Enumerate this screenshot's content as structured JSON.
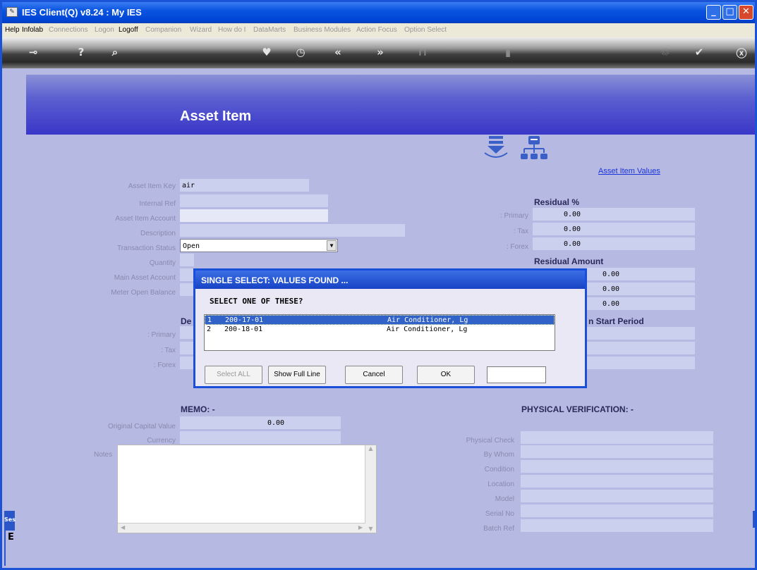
{
  "window": {
    "title": "IES Client(Q) v8.24 : My IES"
  },
  "menu": [
    {
      "label": "Help",
      "on": true
    },
    {
      "label": "Infolab",
      "on": true
    },
    {
      "label": "Connections",
      "on": false
    },
    {
      "label": "Logon",
      "on": false
    },
    {
      "label": "Logoff",
      "on": true
    },
    {
      "label": "Companion",
      "on": false
    },
    {
      "label": "Wizard",
      "on": false
    },
    {
      "label": "How do I",
      "on": false
    },
    {
      "label": "DataMarts",
      "on": false
    },
    {
      "label": "Business Modules",
      "on": false
    },
    {
      "label": "Action Focus",
      "on": false
    },
    {
      "label": "Option Select",
      "on": false
    }
  ],
  "toolbar": {
    "icons": [
      "key-icon",
      "help-icon",
      "search-icon",
      "heart-icon",
      "clock-icon",
      "back-icon",
      "forward-icon",
      "tree-icon",
      "page-icon",
      "recycle-icon",
      "check-icon",
      "close-icon"
    ]
  },
  "page": {
    "title": "Asset Item",
    "asset_values_link": "Asset Item Values"
  },
  "form": {
    "asset_item_key_label": "Asset Item Key",
    "asset_item_key": "air",
    "internal_ref_label": "Internal Ref",
    "asset_item_account_label": "Asset Item Account",
    "description_label": "Description",
    "transaction_status_label": "Transaction Status",
    "transaction_status": "Open",
    "quantity_label": "Quantity",
    "main_asset_account_label": "Main Asset Account",
    "meter_open_balance_label": "Meter Open Balance",
    "de_heading": "De",
    "primary_label": ": Primary",
    "tax_label": ": Tax",
    "forex_label": ": Forex"
  },
  "residual": {
    "pct_heading": "Residual %",
    "primary_label": ": Primary",
    "tax_label": ": Tax",
    "forex_label": ": Forex",
    "pct_primary": "0.00",
    "pct_tax": "0.00",
    "pct_forex": "0.00",
    "amount_heading": "Residual Amount",
    "amt_primary": "0.00",
    "amt_tax": "0.00",
    "amt_forex": "0.00",
    "start_period_heading": "n Start Period"
  },
  "memo": {
    "heading": "MEMO: -",
    "original_capital_label": "Original Capital Value",
    "original_capital": "0.00",
    "currency_label": "Currency",
    "notes_label": "Notes"
  },
  "physical": {
    "heading": "PHYSICAL VERIFICATION: -",
    "labels": [
      "Physical Check",
      "By Whom",
      "Condition",
      "Location",
      "Model",
      "Serial No",
      "Batch Ref"
    ]
  },
  "side": {
    "ses_label": "Ses",
    "e_label": "E"
  },
  "dialog": {
    "title": "SINGLE SELECT: VALUES FOUND ...",
    "prompt": "SELECT ONE OF THESE?",
    "rows": [
      {
        "n": "1",
        "code": "200-17-01",
        "desc": "Air Conditioner, Lg"
      },
      {
        "n": "2",
        "code": "200-18-01",
        "desc": "Air Conditioner, Lg"
      }
    ],
    "select_all": "Select ALL",
    "show_full_line": "Show Full Line",
    "cancel": "Cancel",
    "ok": "OK"
  }
}
